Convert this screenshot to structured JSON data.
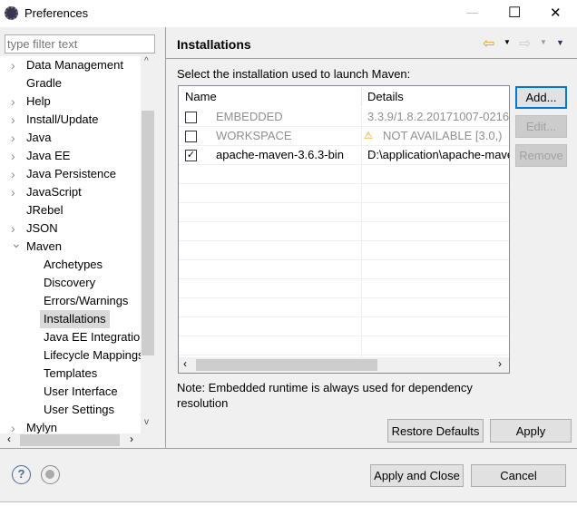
{
  "window": {
    "title": "Preferences",
    "minimize": "—",
    "maximize": "☐",
    "close": "✕"
  },
  "filter": {
    "placeholder": "type filter text"
  },
  "tree": [
    {
      "label": "Data Management",
      "level": 0,
      "expandable": true
    },
    {
      "label": "Gradle",
      "level": 0,
      "expandable": false
    },
    {
      "label": "Help",
      "level": 0,
      "expandable": true
    },
    {
      "label": "Install/Update",
      "level": 0,
      "expandable": true
    },
    {
      "label": "Java",
      "level": 0,
      "expandable": true
    },
    {
      "label": "Java EE",
      "level": 0,
      "expandable": true
    },
    {
      "label": "Java Persistence",
      "level": 0,
      "expandable": true
    },
    {
      "label": "JavaScript",
      "level": 0,
      "expandable": true
    },
    {
      "label": "JRebel",
      "level": 0,
      "expandable": false
    },
    {
      "label": "JSON",
      "level": 0,
      "expandable": true
    },
    {
      "label": "Maven",
      "level": 0,
      "expandable": true,
      "expanded": true
    },
    {
      "label": "Archetypes",
      "level": 1
    },
    {
      "label": "Discovery",
      "level": 1
    },
    {
      "label": "Errors/Warnings",
      "level": 1
    },
    {
      "label": "Installations",
      "level": 1,
      "selected": true
    },
    {
      "label": "Java EE Integration",
      "level": 1
    },
    {
      "label": "Lifecycle Mappings",
      "level": 1
    },
    {
      "label": "Templates",
      "level": 1
    },
    {
      "label": "User Interface",
      "level": 1
    },
    {
      "label": "User Settings",
      "level": 1
    },
    {
      "label": "Mylyn",
      "level": 0,
      "expandable": true
    }
  ],
  "page": {
    "title": "Installations",
    "instruction": "Select the installation used to launch Maven:",
    "columns": [
      "Name",
      "Details"
    ],
    "rows": [
      {
        "name": "EMBEDDED",
        "details": "3.3.9/1.8.2.20171007-0216",
        "checked": false,
        "disabled": true,
        "warning": false
      },
      {
        "name": "WORKSPACE",
        "details": "NOT AVAILABLE [3.0,)",
        "checked": false,
        "disabled": true,
        "warning": true
      },
      {
        "name": "apache-maven-3.6.3-bin",
        "details": "D:\\application\\apache-maven",
        "checked": true,
        "disabled": false,
        "warning": false
      }
    ],
    "add": "Add...",
    "edit": "Edit...",
    "remove": "Remove",
    "note": "Note: Embedded runtime is always used for dependency resolution",
    "restore": "Restore Defaults",
    "apply": "Apply"
  },
  "footer": {
    "apply_close": "Apply and Close",
    "cancel": "Cancel"
  }
}
